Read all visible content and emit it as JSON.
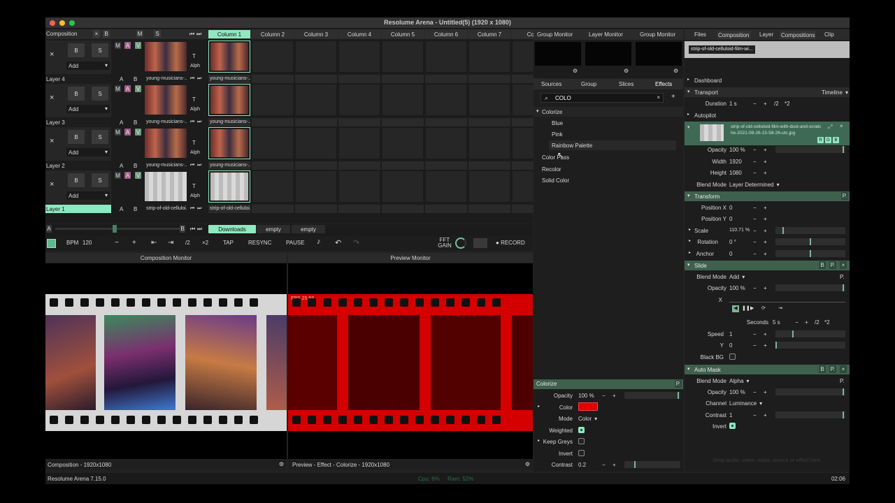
{
  "window": {
    "title": "Resolume Arena - Untitled(5) (1920 x 1080)"
  },
  "composition": {
    "label": "Composition",
    "x_btn": "×",
    "b_btn": "B",
    "m_btn": "M",
    "s_btn": "S",
    "a_btn": "A",
    "v_btn": "V",
    "add_label": "Add",
    "t_label": "T",
    "alph_label": "Alph"
  },
  "columns": [
    "Column 1",
    "Column 2",
    "Column 3",
    "Column 4",
    "Column 5",
    "Column 6",
    "Column 7",
    "Colu"
  ],
  "layers": [
    {
      "name": "Layer 4",
      "clip": "young-musicians-...",
      "clip2": "young-musicians-..."
    },
    {
      "name": "Layer 3",
      "clip": "young-musicians-...",
      "clip2": "young-musicians-..."
    },
    {
      "name": "Layer 2",
      "clip": "young-musicians-...",
      "clip2": "young-musicians-..."
    },
    {
      "name": "Layer 1",
      "clip": "strip-of-old-celluloi...",
      "clip2": "strip-of-old-celluloi..."
    }
  ],
  "deck_bar": {
    "a": "A",
    "b": "B",
    "tabs": [
      "Downloads",
      "empty",
      "empty"
    ]
  },
  "transport_bar": {
    "bpm_label": "BPM",
    "bpm_value": "120",
    "minus": "−",
    "plus": "+",
    "div2": "/2",
    "mul2": "×2",
    "tap": "TAP",
    "resync": "RESYNC",
    "pause": "PAUSE",
    "fft_gain": "FFT\nGAIN",
    "record": "RECORD"
  },
  "monitors": {
    "composition_title": "Composition Monitor",
    "preview_title": "Preview Monitor",
    "composition_footer": "Composition - 1920x1080",
    "preview_footer": "Preview - Effect - Colorize - 1920x1080",
    "fps": "FPS 25.93"
  },
  "status_bar": {
    "version": "Resolume Arena 7.15.0",
    "cpu": "Cpu: 6%",
    "ram": "Ram: 52%",
    "time": "02:06"
  },
  "group_monitor": {
    "tabs": [
      "Group Monitor",
      "Layer Monitor",
      "Group Monitor"
    ]
  },
  "browser": {
    "tabs": [
      "Sources",
      "Group",
      "Slices",
      "Effects"
    ],
    "active_tab": "Effects",
    "search_value": "COLO",
    "tree": [
      {
        "label": "Colorize",
        "expanded": true,
        "children": [
          "Blue",
          "Pink",
          "Rainbow Palette"
        ]
      },
      {
        "label": "Color Pass"
      },
      {
        "label": "Recolor"
      },
      {
        "label": "Solid Color"
      }
    ]
  },
  "colorize_panel": {
    "title": "Colorize",
    "p": "P.",
    "opacity_label": "Opacity",
    "opacity_value": "100 %",
    "color_label": "Color",
    "color_value": "#e00000",
    "mode_label": "Mode",
    "mode_value": "Color",
    "weighted_label": "Weighted",
    "keep_greys_label": "Keep Greys",
    "invert_label": "Invert",
    "contrast_label": "Contrast",
    "contrast_value": "0.2",
    "minus": "−",
    "plus": "+"
  },
  "inspector": {
    "tabs": [
      "Files",
      "Composition",
      "Layer",
      "Compositions",
      "Clip"
    ],
    "clip_name": "strip-of-old-celluloid-film-wi...",
    "dashboard": "Dashboard",
    "transport": "Transport",
    "transport_mode": "Timeline",
    "duration_label": "Duration",
    "duration_value": "1 s",
    "div2": "/2",
    "mul2": "*2",
    "autopilot": "Autopilot",
    "source_name": "strip-of-old-celluloid-film-with-dust-and-scratche-2021-08-26-15-58-26-utc.jpg",
    "rgb": [
      "R",
      "G",
      "B"
    ],
    "opacity_label": "Opacity",
    "opacity_value": "100 %",
    "width_label": "Width",
    "width_value": "1920",
    "height_label": "Height",
    "height_value": "1080",
    "blend_label": "Blend Mode",
    "blend_value": "Layer Determined",
    "transform": "Transform",
    "posx_label": "Position X",
    "posx_value": "0",
    "posy_label": "Position Y",
    "posy_value": "0",
    "scale_label": "Scale",
    "scale_value": "110.71 %",
    "rotation_label": "Rotation",
    "rotation_value": "0 °",
    "anchor_label": "Anchor",
    "anchor_value": "0",
    "slide": "Slide",
    "slide_blend_value": "Add",
    "slide_opacity_value": "100 %",
    "x_label": "X",
    "seconds_label": "Seconds",
    "seconds_value": "5 s",
    "speed_label": "Speed",
    "speed_value": "1",
    "y_label": "Y",
    "y_value": "0",
    "blackbg_label": "Black BG",
    "automask": "Auto Mask",
    "mask_blend_value": "Alpha",
    "mask_opacity_value": "100 %",
    "channel_label": "Channel",
    "channel_value": "Luminance",
    "contrast_label": "Contrast",
    "contrast_value": "1",
    "invert_label": "Invert",
    "drop_hint": "Drop audio, video, mask, source or effect here",
    "b": "B",
    "p": "P.",
    "x": "×",
    "minus": "−",
    "plus": "+"
  }
}
